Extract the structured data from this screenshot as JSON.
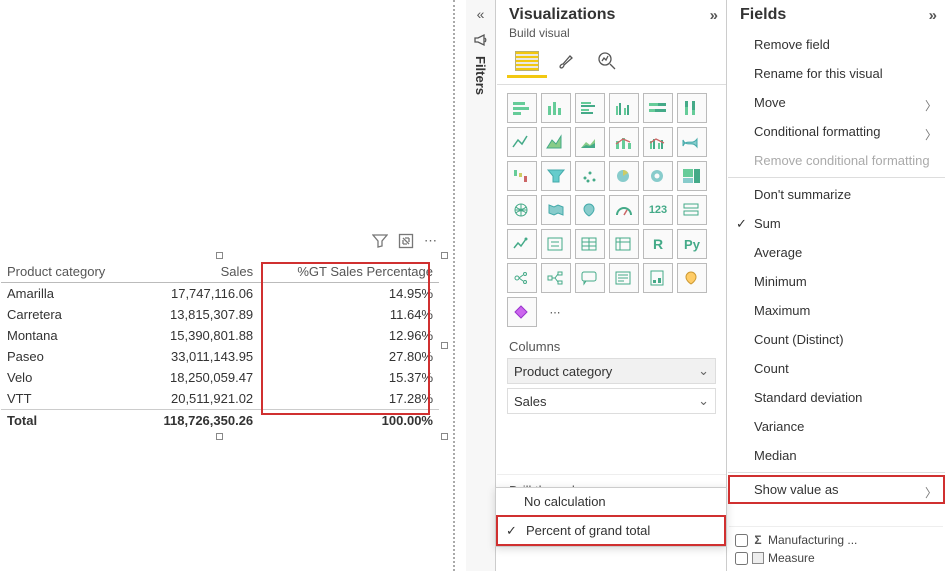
{
  "canvas": {
    "toolbar": {
      "filter": "▽",
      "focus": "⤢",
      "more": "⋯"
    },
    "table": {
      "columns": [
        "Product category",
        "Sales",
        "%GT Sales Percentage"
      ],
      "rows": [
        {
          "cat": "Amarilla",
          "sales": "17,747,116.06",
          "pct": "14.95%"
        },
        {
          "cat": "Carretera",
          "sales": "13,815,307.89",
          "pct": "11.64%"
        },
        {
          "cat": "Montana",
          "sales": "15,390,801.88",
          "pct": "12.96%"
        },
        {
          "cat": "Paseo",
          "sales": "33,011,143.95",
          "pct": "27.80%"
        },
        {
          "cat": "Velo",
          "sales": "18,250,059.47",
          "pct": "15.37%"
        },
        {
          "cat": "VTT",
          "sales": "20,511,921.02",
          "pct": "17.28%"
        }
      ],
      "total_label": "Total",
      "total_sales": "118,726,350.26",
      "total_pct": "100.00%"
    }
  },
  "filters_rail": {
    "label": "Filters"
  },
  "viz_pane": {
    "title": "Visualizations",
    "subtitle": "Build visual",
    "tabs": {
      "build": "Build",
      "format": "Format",
      "analytics": "Analytics"
    },
    "columns_label": "Columns",
    "wells": [
      "Product category",
      "Sales"
    ],
    "drill_label": "Drill through"
  },
  "calc_menu": {
    "items": [
      "No calculation",
      "Percent of grand total"
    ],
    "selected_index": 1
  },
  "fields_pane": {
    "title": "Fields"
  },
  "context_menu": {
    "items": [
      {
        "label": "Remove field"
      },
      {
        "label": "Rename for this visual"
      },
      {
        "label": "Move",
        "sub": true
      },
      {
        "label": "Conditional formatting",
        "sub": true
      },
      {
        "label": "Remove conditional formatting",
        "disabled": true
      },
      {
        "sep": true
      },
      {
        "label": "Don't summarize"
      },
      {
        "label": "Sum",
        "checked": true
      },
      {
        "label": "Average"
      },
      {
        "label": "Minimum"
      },
      {
        "label": "Maximum"
      },
      {
        "label": "Count (Distinct)"
      },
      {
        "label": "Count"
      },
      {
        "label": "Standard deviation"
      },
      {
        "label": "Variance"
      },
      {
        "label": "Median"
      },
      {
        "sep": true
      },
      {
        "label": "Show value as",
        "sub": true,
        "boxed": true
      }
    ]
  },
  "fields_list": {
    "items": [
      {
        "icon": "sigma",
        "label": "Manufacturing ..."
      },
      {
        "icon": "measure",
        "label": "Measure"
      }
    ]
  },
  "chart_data": {
    "type": "table",
    "title": "",
    "columns": [
      "Product category",
      "Sales",
      "%GT Sales Percentage"
    ],
    "rows": [
      [
        "Amarilla",
        17747116.06,
        14.95
      ],
      [
        "Carretera",
        13815307.89,
        11.64
      ],
      [
        "Montana",
        15390801.88,
        12.96
      ],
      [
        "Paseo",
        33011143.95,
        27.8
      ],
      [
        "Velo",
        18250059.47,
        15.37
      ],
      [
        "VTT",
        20511921.02,
        17.28
      ]
    ],
    "totals": [
      "Total",
      118726350.26,
      100.0
    ]
  }
}
